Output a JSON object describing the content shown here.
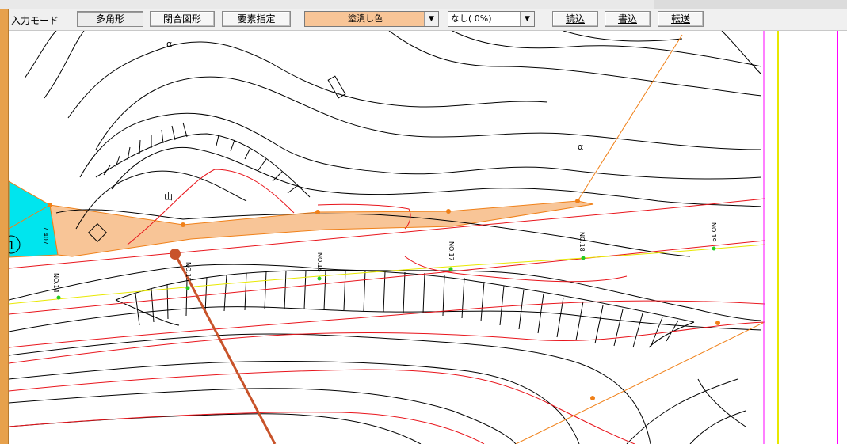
{
  "toolbar": {
    "mode_label": "入力モード",
    "btn_polygon": "多角形",
    "btn_closed_shape": "閉合図形",
    "btn_element_select": "要素指定",
    "fill_color_select": "塗潰し色",
    "hatch_select": "なし( 0%)",
    "btn_read": "読込",
    "btn_write": "書込",
    "btn_transfer": "転送"
  },
  "map": {
    "station_labels": [
      "NO.14",
      "NO.15",
      "NO.16",
      "NO.17",
      "NO.18",
      "NO.19"
    ],
    "contour_symbols": [
      "α",
      "α"
    ],
    "mountain_symbol": "山",
    "circle_marker": "1",
    "dimension_label": "7.407"
  },
  "colors": {
    "fill_region": "#f8c597",
    "cyan_region": "#00e5ee",
    "contour": "#000000",
    "red_line": "#e8141b",
    "orange_line": "#f08018",
    "yellow_line": "#e8e800",
    "magenta_border": "#ff00ff",
    "pointer": "#c8532a",
    "fill_color_swatch": "#f8c597"
  }
}
